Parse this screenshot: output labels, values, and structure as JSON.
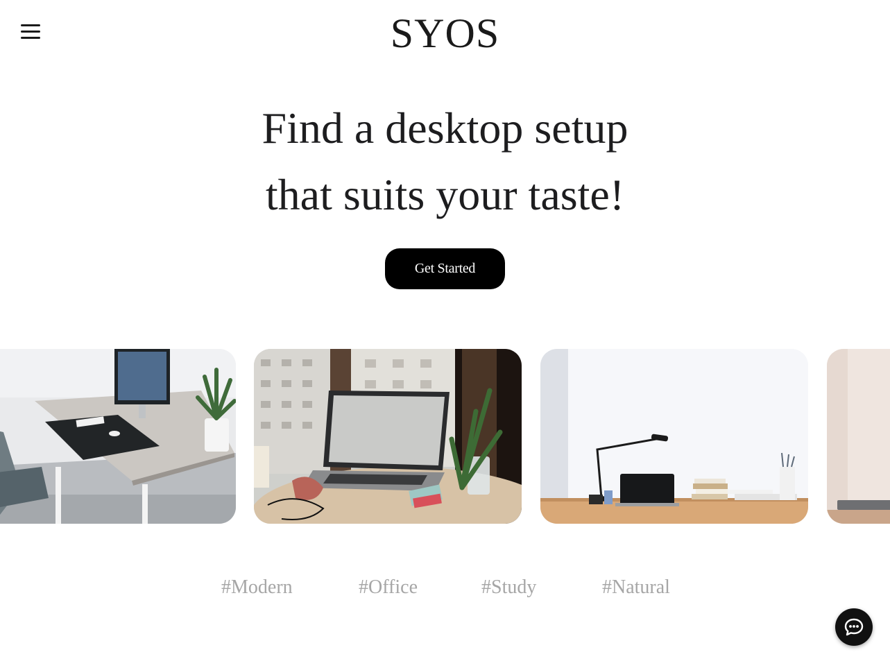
{
  "header": {
    "menu_icon": "hamburger-menu-icon",
    "logo": "SYOS"
  },
  "hero": {
    "line1": "Find a desktop setup",
    "line2": "that suits your taste!",
    "cta_label": "Get Started"
  },
  "gallery": {
    "cards": [
      {
        "subject": "white desk with monitor, keyboard, chair and potted plant"
      },
      {
        "subject": "laptop on round wooden table by window with plant and glass"
      },
      {
        "subject": "bright room with desk lamp, laptop and stacked books"
      },
      {
        "subject": "partially visible desk with laptop"
      }
    ]
  },
  "tags": [
    "#Modern",
    "#Office",
    "#Study",
    "#Natural"
  ],
  "chat": {
    "icon": "chat-bubble-icon"
  },
  "colors": {
    "text": "#1a1a1a",
    "cta_background": "#000000",
    "cta_text": "#ffffff",
    "tag_text": "#a6a6a6",
    "chat_background": "#111111"
  }
}
